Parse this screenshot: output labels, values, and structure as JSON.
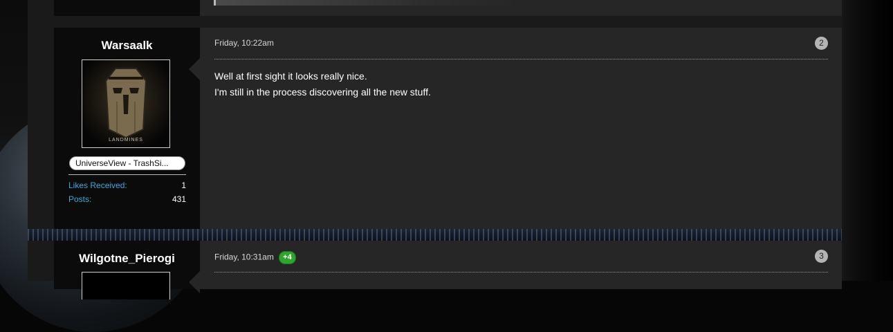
{
  "posts": [
    {
      "username": "Warsaalk",
      "usertitle": "UniverseView - TrashSi...",
      "stats": [
        {
          "label": "Likes Received",
          "value": "1"
        },
        {
          "label": "Posts",
          "value": "431"
        }
      ],
      "date": "Friday, 10:22am",
      "post_number": "2",
      "body": [
        "Well at first sight it looks really nice.",
        "I'm still in the process discovering all the new stuff."
      ],
      "avatar_caption": "LANDMINES"
    },
    {
      "username": "Wilgotne_Pierogi",
      "date": "Friday, 10:31am",
      "likes_badge": "+4",
      "post_number": "3"
    }
  ],
  "colors": {
    "username": "#ffffff",
    "stat_label": "#3fa7dc",
    "like_badge": "#2ea52e",
    "message_bg": "#262626",
    "userinfo_bg": "#0b0b0b"
  }
}
